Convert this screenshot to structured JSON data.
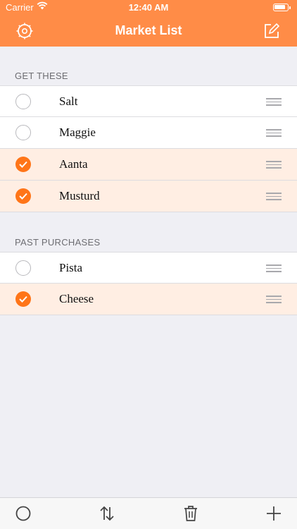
{
  "status_bar": {
    "carrier": "Carrier",
    "time": "12:40 AM"
  },
  "nav": {
    "title": "Market List",
    "left_icon": "settings-gear-icon",
    "right_icon": "compose-icon"
  },
  "sections": [
    {
      "header": "GET THESE",
      "items": [
        {
          "label": "Salt",
          "checked": false
        },
        {
          "label": "Maggie",
          "checked": false
        },
        {
          "label": "Aanta",
          "checked": true
        },
        {
          "label": "Musturd",
          "checked": true
        }
      ]
    },
    {
      "header": "PAST PURCHASES",
      "items": [
        {
          "label": "Pista",
          "checked": false
        },
        {
          "label": "Cheese",
          "checked": true
        }
      ]
    }
  ],
  "toolbar": {
    "icons": [
      "circle-icon",
      "sort-icon",
      "trash-icon",
      "plus-icon"
    ]
  },
  "colors": {
    "accent": "#ff8c47",
    "checked_fill": "#ff7518",
    "checked_row_bg": "#ffeee3"
  }
}
